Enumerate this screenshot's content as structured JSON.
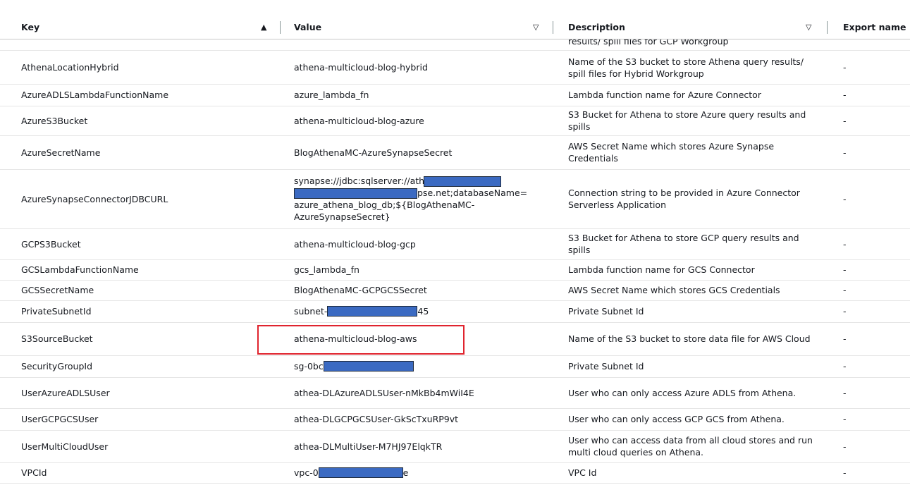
{
  "columns": {
    "key": "Key",
    "value": "Value",
    "description": "Description",
    "export": "Export name"
  },
  "sort_icons": {
    "key": "sort-ascending-icon",
    "value": "sort-descending-icon",
    "description": "sort-descending-icon"
  },
  "partial_row": {
    "description": "results/ spill files for GCP Workgroup"
  },
  "rows": [
    {
      "key": "AthenaLocationHybrid",
      "value": "athena-multicloud-blog-hybrid",
      "description": "Name of the S3 bucket to store Athena query results/ spill files for Hybrid Workgroup",
      "export": "-"
    },
    {
      "key": "AzureADLSLambdaFunctionName",
      "value": "azure_lambda_fn",
      "description": "Lambda function name for Azure Connector",
      "export": "-"
    },
    {
      "key": "AzureS3Bucket",
      "value": "athena-multicloud-blog-azure",
      "description": "S3 Bucket for Athena to store Azure query results and spills",
      "export": "-"
    },
    {
      "key": "AzureSecretName",
      "value": "BlogAthenaMC-AzureSynapseSecret",
      "description": "AWS Secret Name which stores Azure Synapse Credentials",
      "export": "-"
    },
    {
      "key": "AzureSynapseConnectorJDBCURL",
      "value_line1": "synapse://jdbc:sqlserver://ath",
      "value_line2": "pse.net;databaseName=",
      "value_line3": "azure_athena_blog_db;${BlogAthenaMC-",
      "value_line4": "AzureSynapseSecret}",
      "description": "Connection string to be provided in Azure Connector Serverless Application",
      "export": "-"
    },
    {
      "key": "GCPS3Bucket",
      "value": "athena-multicloud-blog-gcp",
      "description": "S3 Bucket for Athena to store GCP query results and spills",
      "export": "-"
    },
    {
      "key": "GCSLambdaFunctionName",
      "value": "gcs_lambda_fn",
      "description": "Lambda function name for GCS Connector",
      "export": "-"
    },
    {
      "key": "GCSSecretName",
      "value": "BlogAthenaMC-GCPGCSSecret",
      "description": "AWS Secret Name which stores GCS Credentials",
      "export": "-"
    },
    {
      "key": "PrivateSubnetId",
      "value_prefix": "subnet-",
      "value_suffix": "45",
      "description": "Private Subnet Id",
      "export": "-"
    },
    {
      "key": "S3SourceBucket",
      "value": "athena-multicloud-blog-aws",
      "description": "Name of the S3 bucket to store data file for AWS Cloud",
      "export": "-"
    },
    {
      "key": "SecurityGroupId",
      "value_prefix": "sg-0bc",
      "value_suffix": "",
      "description": "Private Subnet Id",
      "export": "-"
    },
    {
      "key": "UserAzureADLSUser",
      "value": "athea-DLAzureADLSUser-nMkBb4mWiI4E",
      "description": "User who can only access Azure ADLS from Athena.",
      "export": "-"
    },
    {
      "key": "UserGCPGCSUser",
      "value": "athea-DLGCPGCSUser-GkScTxuRP9vt",
      "description": "User who can only access GCP GCS from Athena.",
      "export": "-"
    },
    {
      "key": "UserMultiCloudUser",
      "value": "athea-DLMultiUser-M7HJ97ElqkTR",
      "description": "User who can access data from all cloud stores and run multi cloud queries on Athena.",
      "export": "-"
    },
    {
      "key": "VPCId",
      "value_prefix": "vpc-0",
      "value_suffix": "e",
      "description": "VPC Id",
      "export": "-"
    }
  ]
}
